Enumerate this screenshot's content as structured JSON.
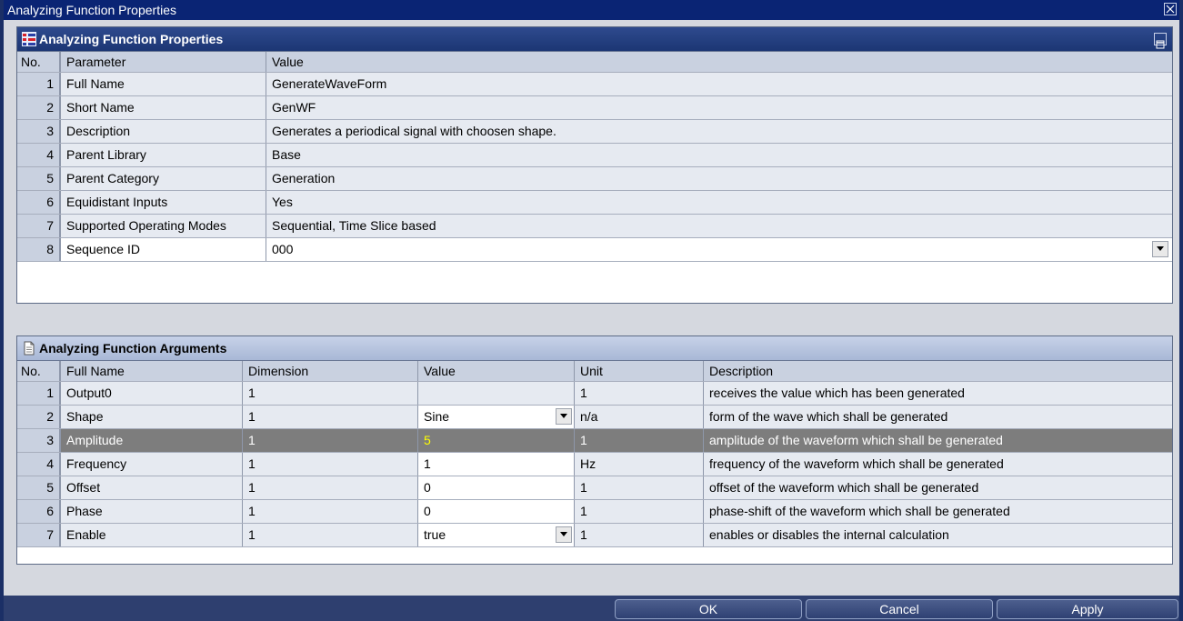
{
  "window": {
    "title": "Analyzing Function Properties"
  },
  "properties": {
    "title": "Analyzing Function Properties",
    "headers": {
      "no": "No.",
      "param": "Parameter",
      "value": "Value"
    },
    "rows": [
      {
        "no": "1",
        "param": "Full Name",
        "value": "GenerateWaveForm"
      },
      {
        "no": "2",
        "param": "Short Name",
        "value": "GenWF"
      },
      {
        "no": "3",
        "param": "Description",
        "value": "Generates a periodical signal with choosen shape."
      },
      {
        "no": "4",
        "param": "Parent Library",
        "value": "Base"
      },
      {
        "no": "5",
        "param": "Parent Category",
        "value": "Generation"
      },
      {
        "no": "6",
        "param": "Equidistant Inputs",
        "value": "Yes"
      },
      {
        "no": "7",
        "param": "Supported Operating Modes",
        "value": "Sequential, Time Slice based"
      },
      {
        "no": "8",
        "param": "Sequence ID",
        "value": "000"
      }
    ]
  },
  "arguments": {
    "title": "Analyzing Function Arguments",
    "headers": {
      "no": "No.",
      "name": "Full Name",
      "dim": "Dimension",
      "value": "Value",
      "unit": "Unit",
      "desc": "Description"
    },
    "rows": [
      {
        "no": "1",
        "name": "Output0",
        "dim": "1",
        "value": "",
        "unit": "1",
        "desc": "receives the value which has been generated"
      },
      {
        "no": "2",
        "name": "Shape",
        "dim": "1",
        "value": "Sine",
        "unit": "n/a",
        "desc": "form of the wave which shall be generated"
      },
      {
        "no": "3",
        "name": "Amplitude",
        "dim": "1",
        "value": "5",
        "unit": "1",
        "desc": "amplitude of the waveform which shall be generated"
      },
      {
        "no": "4",
        "name": "Frequency",
        "dim": "1",
        "value": "1",
        "unit": "Hz",
        "desc": "frequency of the waveform which shall be generated"
      },
      {
        "no": "5",
        "name": "Offset",
        "dim": "1",
        "value": "0",
        "unit": "1",
        "desc": "offset of the waveform which shall be generated"
      },
      {
        "no": "6",
        "name": "Phase",
        "dim": "1",
        "value": "0",
        "unit": "1",
        "desc": "phase-shift of the waveform which shall be generated"
      },
      {
        "no": "7",
        "name": "Enable",
        "dim": "1",
        "value": "true",
        "unit": "1",
        "desc": "enables or disables the internal calculation"
      }
    ]
  },
  "buttons": {
    "ok": "OK",
    "cancel": "Cancel",
    "apply": "Apply"
  },
  "colors": {
    "titlebar": "#0a2474",
    "selected_row": "#7d7d7d",
    "highlight_value": "#ffff00"
  }
}
